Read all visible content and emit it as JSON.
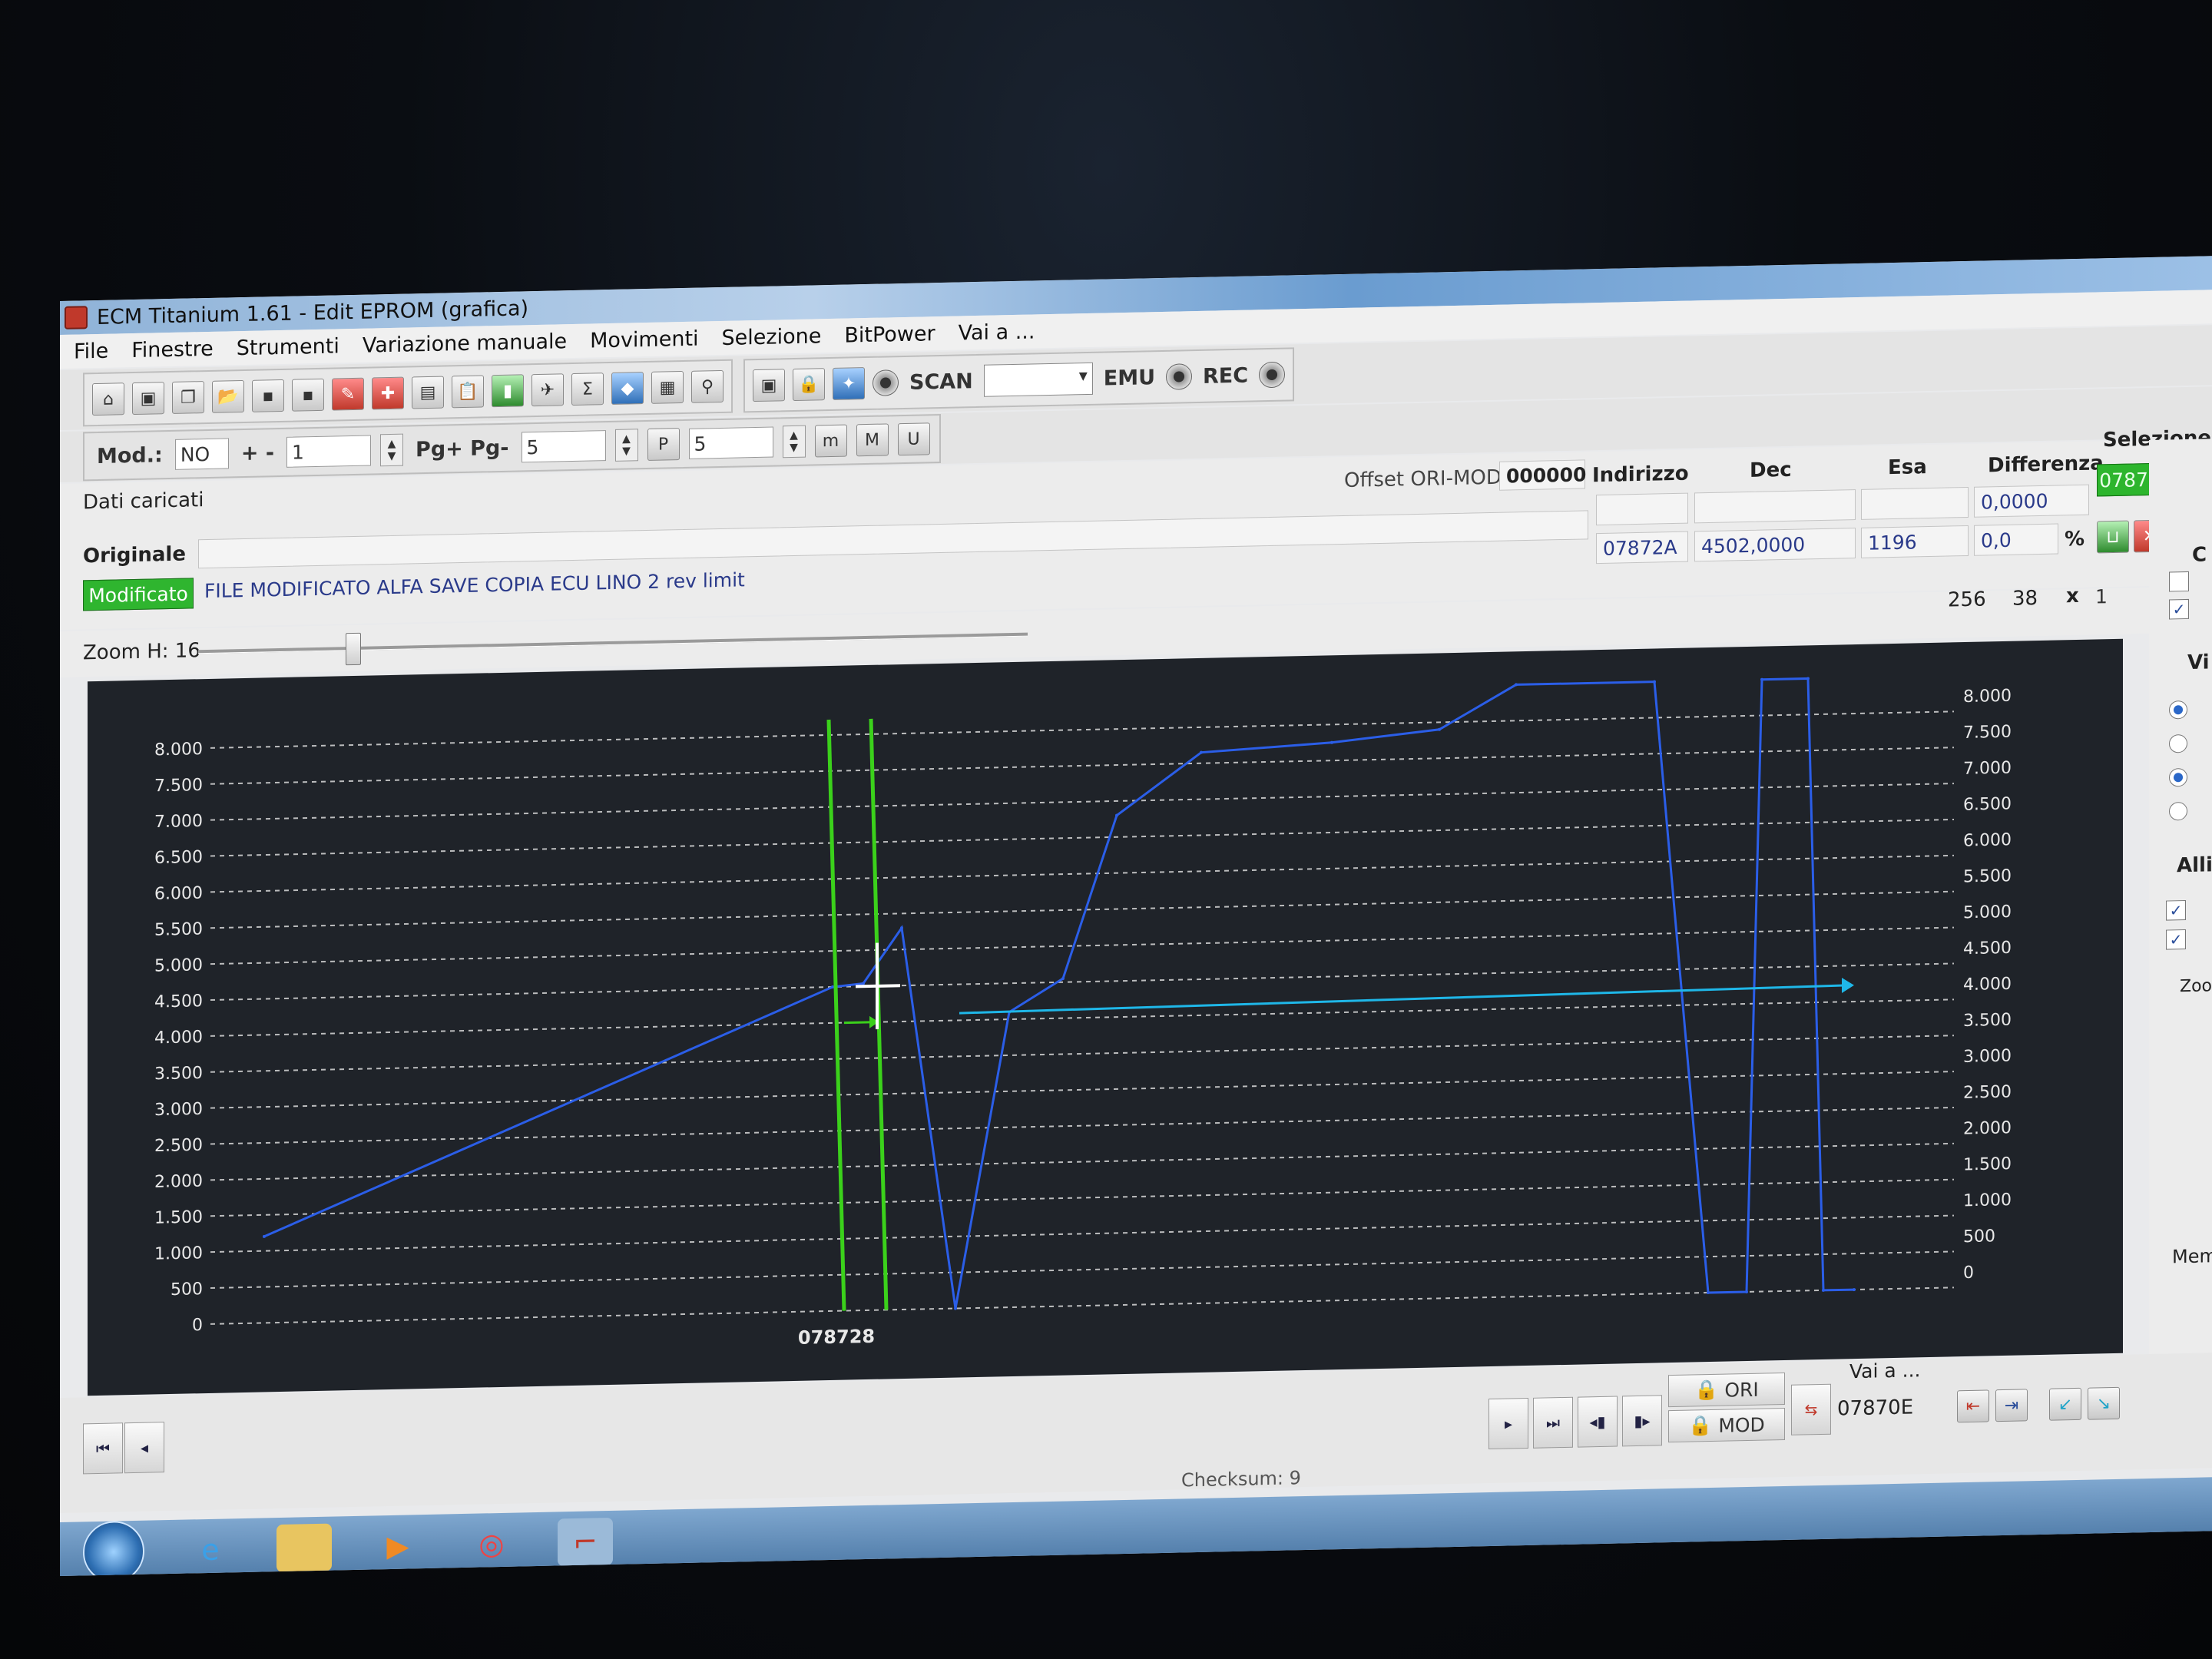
{
  "window": {
    "title": "ECM Titanium 1.61 - Edit EPROM (grafica)"
  },
  "menu": [
    "File",
    "Finestre",
    "Strumenti",
    "Variazione manuale",
    "Movimenti",
    "Selezione",
    "BitPower",
    "Vai a ..."
  ],
  "toolbar": {
    "scan_label": "SCAN",
    "emu_label": "EMU",
    "rec_label": "REC"
  },
  "toolbar2": {
    "mod_label": "Mod.:",
    "mod_value": "NO",
    "plusminus_label": "+ -",
    "plusminus_value": "1",
    "pg_label": "Pg+ Pg-",
    "pg_value": "5",
    "p_value": "5"
  },
  "info": {
    "dati_caricati": "Dati caricati",
    "offset_label": "Offset ORI-MOD",
    "offset_value": "000000",
    "indirizzo_label": "Indirizzo",
    "dec_label": "Dec",
    "esa_label": "Esa",
    "differenza_label": "Differenza",
    "selezione_label": "Selezione",
    "differenza_top": "0,0000",
    "originale_label": "Originale",
    "modificato_label": "Modificato",
    "modificato_file": "FILE MODIFICATO ALFA SAVE COPIA ECU LINO 2 rev limit",
    "indirizzo_value": "07872A",
    "dec_value": "4502,0000",
    "esa_value": "1196",
    "percent_value": "0,0",
    "percent_sign": "%",
    "sel_start": "078728",
    "sel_end": "078"
  },
  "zoom": {
    "label": "Zoom H: 16",
    "w": "256",
    "h": "38",
    "x_label": "x",
    "mult": "1"
  },
  "right_panel": {
    "c": "C",
    "vi": "Vi",
    "alli": "Alli",
    "zoom": "Zoo",
    "mem": "Mem"
  },
  "chart_data": {
    "type": "line",
    "ylim": [
      0,
      8000
    ],
    "y_ticks_left": [
      "8.000",
      "7.500",
      "7.000",
      "6.500",
      "6.000",
      "5.500",
      "5.000",
      "4.500",
      "4.000",
      "3.500",
      "3.000",
      "2.500",
      "2.000",
      "1.500",
      "1.000",
      "500",
      "0"
    ],
    "y_ticks_right": [
      "8.000",
      "7.500",
      "7.000",
      "6.500",
      "6.000",
      "5.500",
      "5.000",
      "4.500",
      "4.000",
      "3.500",
      "3.000",
      "2.500",
      "2.000",
      "1.500",
      "1.000",
      "500",
      "0"
    ],
    "x_label": "078728",
    "series": [
      {
        "values": [
          1200,
          4500,
          4540,
          5300,
          0,
          4100,
          4550,
          6800,
          7650,
          7750,
          7900,
          8500,
          8500,
          0,
          0,
          8500,
          8500,
          0,
          0
        ]
      }
    ],
    "arrow_value": 4100,
    "colors": {
      "series": "#2b5ee8",
      "marker": "#3bd11b",
      "arrow": "#1fb7e8",
      "bg": "#1f2329",
      "grid": "#d8d8d8"
    }
  },
  "bottom": {
    "ori_label": "ORI",
    "mod_label": "MOD",
    "vai_a_label": "Vai a ...",
    "vai_a_value": "07870E",
    "checksum": "Checksum: 9"
  }
}
